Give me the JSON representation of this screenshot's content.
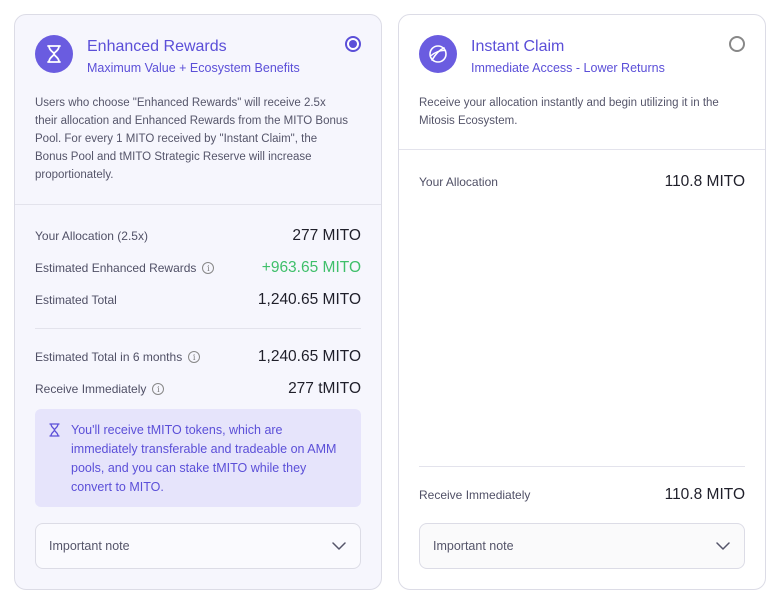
{
  "enhanced": {
    "title": "Enhanced Rewards",
    "subtitle": "Maximum Value + Ecosystem Benefits",
    "selected": true,
    "icon": "hourglass-icon",
    "description": "Users who choose \"Enhanced Rewards\" will receive 2.5x their allocation and Enhanced Rewards from the MITO Bonus Pool. For every 1 MITO received by \"Instant Claim\", the Bonus Pool and tMITO Strategic Reserve will increase proportionately.",
    "rows": [
      {
        "label": "Your Allocation (2.5x)",
        "value": "277 MITO"
      },
      {
        "label": "Estimated Enhanced Rewards",
        "value": "+963.65 MITO"
      },
      {
        "label": "Estimated Total",
        "value": "1,240.65 MITO"
      },
      {
        "label": "Estimated Total in 6 months",
        "value": "1,240.65 MITO"
      },
      {
        "label": "Receive Immediately",
        "value": "277 tMITO"
      }
    ],
    "notice": "You'll receive tMITO tokens, which are immediately transferable and tradeable on AMM pools, and you can stake tMITO while they convert to MITO.",
    "note_label": "Important note"
  },
  "instant": {
    "title": "Instant Claim",
    "subtitle": "Immediate Access - Lower Returns",
    "selected": false,
    "icon": "orbit-globe-icon",
    "description": "Receive your allocation instantly and begin utilizing it in the Mitosis Ecosystem.",
    "rows": [
      {
        "label": "Your Allocation",
        "value": "110.8 MITO"
      },
      {
        "label": "Receive Immediately",
        "value": "110.8 MITO"
      }
    ],
    "note_label": "Important note"
  },
  "colors": {
    "accent": "#5b4fd8",
    "positive": "#3fbf6a",
    "notice_bg": "#e6e4fb"
  }
}
